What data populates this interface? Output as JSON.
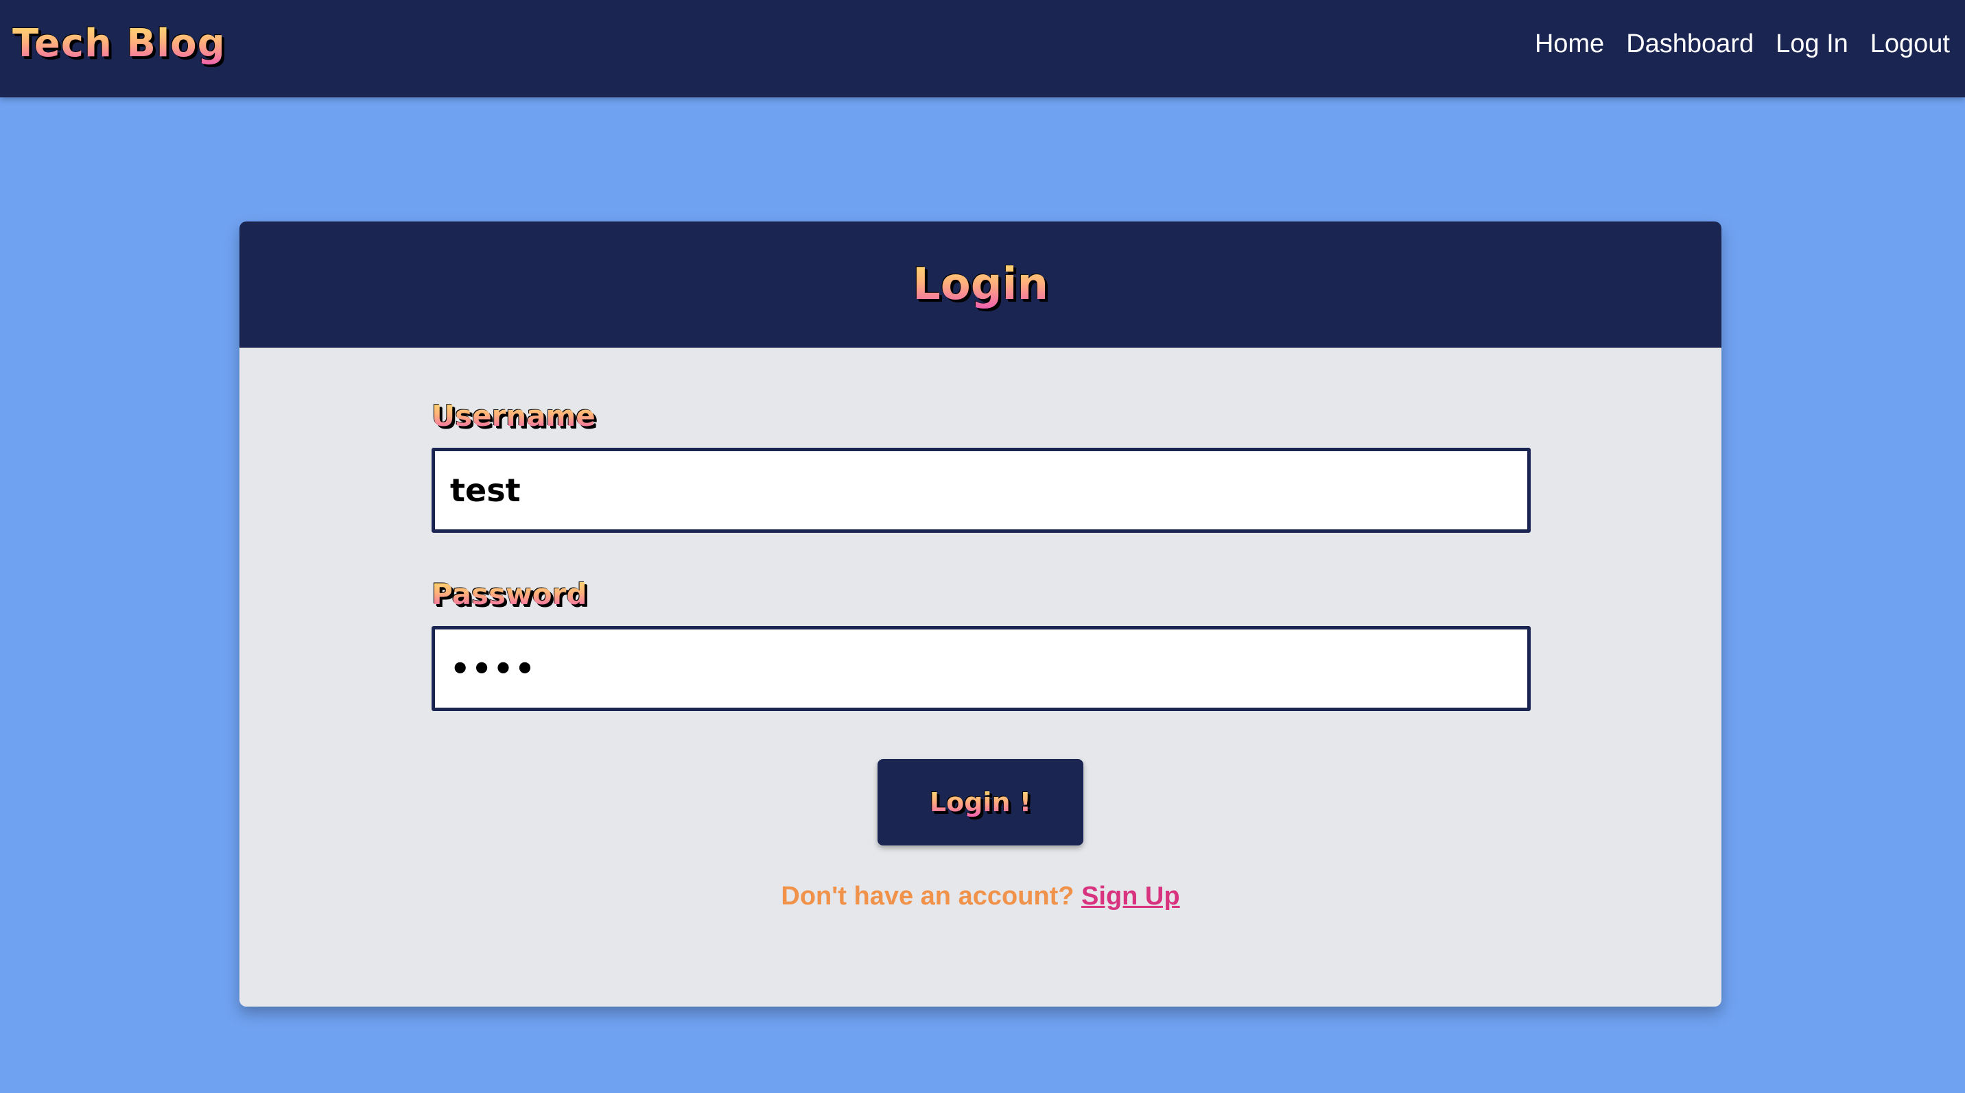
{
  "navbar": {
    "brand": "Tech Blog",
    "links": [
      "Home",
      "Dashboard",
      "Log In",
      "Logout"
    ]
  },
  "login_card": {
    "title": "Login",
    "username_label": "Username",
    "username_value": "test",
    "password_label": "Password",
    "password_value": "test",
    "submit_label": "Login !",
    "signup_prompt": "Don't have an account?",
    "signup_link": "Sign Up"
  },
  "colors": {
    "background": "#70a2f2",
    "navy": "#1b2552",
    "card": "#e5e7eb",
    "prompt_orange": "#f0924a",
    "link_pink": "#d7337f"
  }
}
